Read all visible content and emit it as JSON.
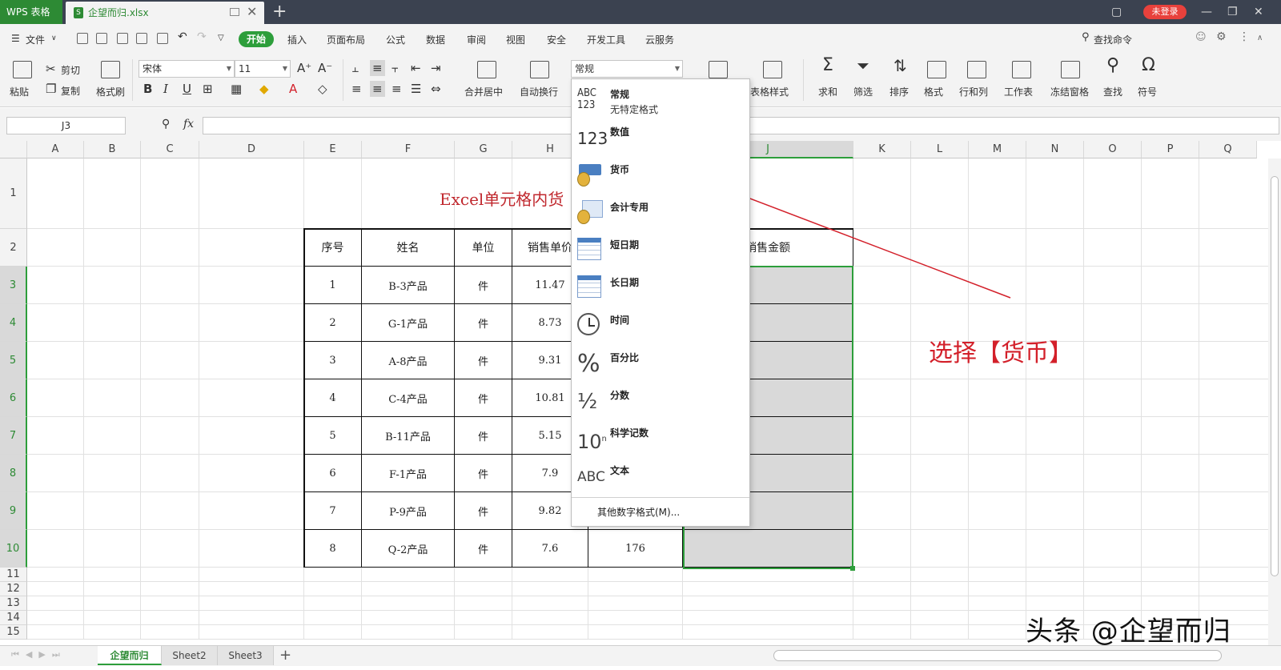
{
  "titlebar": {
    "app_name": "WPS 表格",
    "file_tab": "企望而归.xlsx",
    "login": "未登录"
  },
  "menubar": {
    "file": "文件",
    "active": "开始",
    "items": [
      "插入",
      "页面布局",
      "公式",
      "数据",
      "审阅",
      "视图",
      "安全",
      "开发工具",
      "云服务"
    ],
    "search": "查找命令"
  },
  "ribbon": {
    "paste": "粘贴",
    "cut": "剪切",
    "copy": "复制",
    "format_painter": "格式刷",
    "font_name": "宋体",
    "font_size": "11",
    "merge_center": "合并居中",
    "wrap_text": "自动换行",
    "number_format": "常规",
    "table_style": "表格样式",
    "sum": "求和",
    "filter": "筛选",
    "sort": "排序",
    "format": "格式",
    "row_col": "行和列",
    "worksheet": "工作表",
    "freeze": "冻结窗格",
    "find": "查找",
    "symbol": "符号"
  },
  "formula_bar": {
    "name_box": "J3",
    "fx": "fx",
    "value": ""
  },
  "columns": [
    "A",
    "B",
    "C",
    "D",
    "E",
    "F",
    "G",
    "H",
    "I",
    "J",
    "K",
    "L",
    "M",
    "N",
    "O",
    "P",
    "Q"
  ],
  "rows": [
    "1",
    "2",
    "3",
    "4",
    "5",
    "6",
    "7",
    "8",
    "9",
    "10",
    "11",
    "12",
    "13",
    "14",
    "15"
  ],
  "sheet": {
    "title": "Excel单元格内货",
    "headers": [
      "序号",
      "姓名",
      "单位",
      "销售单价",
      "",
      "销售金额"
    ],
    "rows": [
      [
        "1",
        "B-3产品",
        "件",
        "11.47",
        ""
      ],
      [
        "2",
        "G-1产品",
        "件",
        "8.73",
        ""
      ],
      [
        "3",
        "A-8产品",
        "件",
        "9.31",
        ""
      ],
      [
        "4",
        "C-4产品",
        "件",
        "10.81",
        ""
      ],
      [
        "5",
        "B-11产品",
        "件",
        "5.15",
        ""
      ],
      [
        "6",
        "F-1产品",
        "件",
        "7.9",
        ""
      ],
      [
        "7",
        "P-9产品",
        "件",
        "9.82",
        ""
      ],
      [
        "8",
        "Q-2产品",
        "件",
        "7.6",
        "176"
      ]
    ]
  },
  "dropdown": {
    "items": [
      {
        "label": "常规",
        "sub": "无特定格式",
        "icon": "general-format-icon"
      },
      {
        "label": "数值",
        "sub": "",
        "icon": "number-format-icon"
      },
      {
        "label": "货币",
        "sub": "",
        "icon": "currency-format-icon"
      },
      {
        "label": "会计专用",
        "sub": "",
        "icon": "accounting-format-icon"
      },
      {
        "label": "短日期",
        "sub": "",
        "icon": "short-date-icon"
      },
      {
        "label": "长日期",
        "sub": "",
        "icon": "long-date-icon"
      },
      {
        "label": "时间",
        "sub": "",
        "icon": "clock-icon"
      },
      {
        "label": "百分比",
        "sub": "",
        "icon": "percent-icon"
      },
      {
        "label": "分数",
        "sub": "",
        "icon": "fraction-icon"
      },
      {
        "label": "科学记数",
        "sub": "",
        "icon": "scientific-icon"
      },
      {
        "label": "文本",
        "sub": "",
        "icon": "text-format-icon"
      }
    ],
    "more": "其他数字格式(M)..."
  },
  "annotation": "选择【货币】",
  "watermark": "头条 @企望而归",
  "sheets": [
    "企望而归",
    "Sheet2",
    "Sheet3"
  ],
  "colors": {
    "accent": "#2d9e3b",
    "annotation": "#d3202a",
    "titlebar": "#3b4250"
  }
}
